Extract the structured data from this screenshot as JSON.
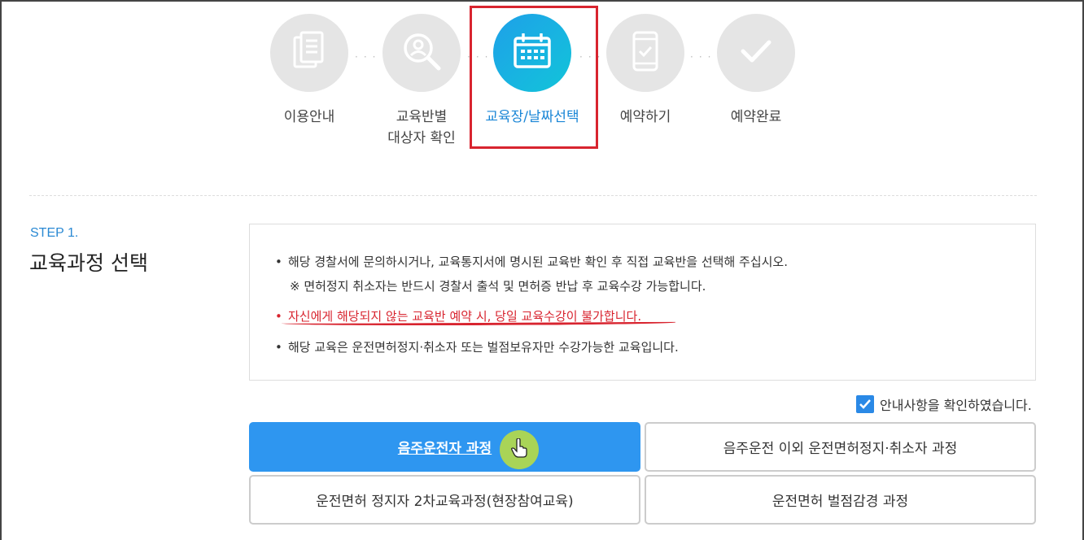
{
  "stepper": {
    "steps": [
      {
        "label_line1": "이용안내",
        "label_line2": "",
        "icon": "document-icon",
        "active": false
      },
      {
        "label_line1": "교육반별",
        "label_line2": "대상자 확인",
        "icon": "person-search-icon",
        "active": false
      },
      {
        "label_line1": "교육장/날짜선택",
        "label_line2": "",
        "icon": "calendar-icon",
        "active": true
      },
      {
        "label_line1": "예약하기",
        "label_line2": "",
        "icon": "phone-check-icon",
        "active": false
      },
      {
        "label_line1": "예약완료",
        "label_line2": "",
        "icon": "checkmark-icon",
        "active": false
      }
    ],
    "separator": "···"
  },
  "section": {
    "step_number": "STEP 1.",
    "title": "교육과정 선택"
  },
  "notices": {
    "n1": "해당 경찰서에 문의하시거나, 교육통지서에 명시된 교육반 확인 후 직접 교육반을 선택해 주십시오.",
    "n1_sub": "※ 면허정지 취소자는 반드시 경찰서 출석 및 면허증 반납 후 교육수강 가능합니다.",
    "n2": "자신에게 해당되지 않는 교육반 예약 시, 당일 교육수강이 불가합니다.",
    "n3": "해당 교육은 운전면허정지·취소자 또는 벌점보유자만 수강가능한 교육입니다.",
    "bullet": "•"
  },
  "confirm": {
    "label": "안내사항을 확인하였습니다.",
    "checked": true
  },
  "courses": {
    "c1": "음주운전자 과정",
    "c2": "음주운전 이외 운전면허정지·취소자 과정",
    "c3": "운전면허 정지자 2차교육과정(현장참여교육)",
    "c4": "운전면허 벌점감경 과정"
  },
  "colors": {
    "accent": "#2e96f0",
    "active_step": "#1a86d6",
    "warning": "#d8242f",
    "inactive_circle": "#e5e5e5"
  }
}
